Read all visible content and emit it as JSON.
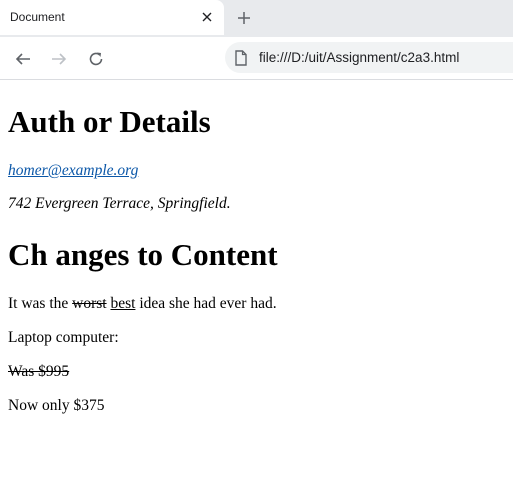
{
  "browser": {
    "tab": {
      "title": "Document",
      "close_icon": "close-icon"
    },
    "new_tab_icon": "plus-icon",
    "toolbar": {
      "back_icon": "arrow-left-icon",
      "forward_icon": "arrow-right-icon",
      "reload_icon": "reload-icon",
      "address_bar": {
        "page_icon": "file-icon",
        "url": "file:///D:/uit/Assignment/c2a3.html"
      }
    }
  },
  "page": {
    "author_heading": "Auth or Details",
    "email": "homer@example.org",
    "address": "742 Evergreen Terrace, Springfield.",
    "changes_heading": "Ch anges to Content",
    "sentence": {
      "before": "It was the ",
      "deleted": "worst",
      "between": " ",
      "inserted": "best",
      "after": " idea she had ever had."
    },
    "laptop_label": "Laptop computer:",
    "old_price": "Was $995",
    "new_price": "Now only $375"
  },
  "colors": {
    "tabstrip_bg": "#e8eaed",
    "omnibox_bg": "#f1f3f4",
    "link": "#0b57a8",
    "icon": "#5f6368",
    "icon_disabled": "#bdc1c6"
  }
}
